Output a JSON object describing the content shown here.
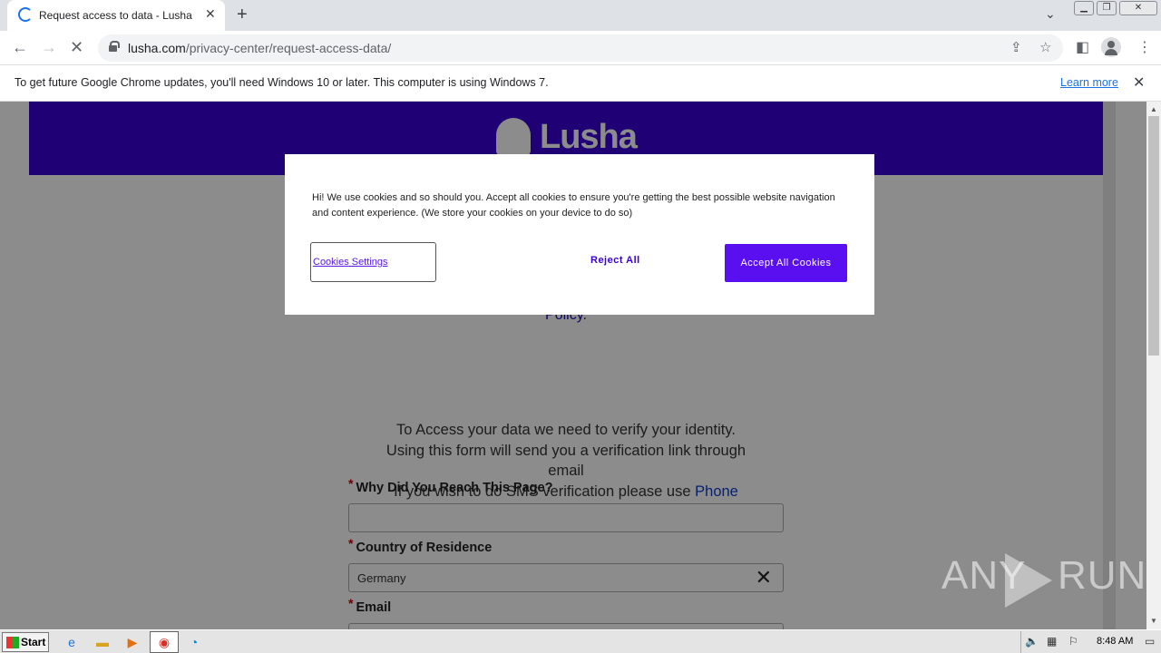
{
  "browser": {
    "tab_title": "Request access to data - Lusha",
    "new_tab_icon": "+",
    "url_domain": "lusha.com",
    "url_path": "/privacy-center/request-access-data/"
  },
  "infobar": {
    "message": "To get future Google Chrome updates, you'll need Windows 10 or later. This computer is using Windows 7.",
    "link": "Learn more"
  },
  "header": {
    "logo_text": "Lusha"
  },
  "page": {
    "policy_link": "Policy",
    "policy_period": ".",
    "intro_line1": "To Access your data we need to verify your identity.",
    "intro_line2": "Using this form will send you a verification link through email",
    "intro_line3": "If you wish to do SMS verification please use",
    "intro_link": "Phone Verification form"
  },
  "form": {
    "required_mark": "*",
    "field1_label": "Why Did You Reach This Page?",
    "field1_value": "",
    "field2_label": "Country of Residence",
    "field2_value": "Germany",
    "field3_label": "Email"
  },
  "cookie_banner": {
    "message": "Hi! We use cookies and so should you. Accept all cookies to ensure you're getting the best possible website navigation and content experience. (We store your cookies on your device to do so)",
    "settings_button": "Cookies Settings",
    "reject_button": "Reject All",
    "accept_button": "Accept All Cookies"
  },
  "watermark": {
    "left": "ANY",
    "right": "RUN"
  },
  "taskbar": {
    "start_label": "Start",
    "clock": "8:48 AM"
  },
  "colors": {
    "brand_purple": "#3a00d6",
    "accept_button": "#5a0ff0",
    "link_blue": "#1a73e8"
  }
}
